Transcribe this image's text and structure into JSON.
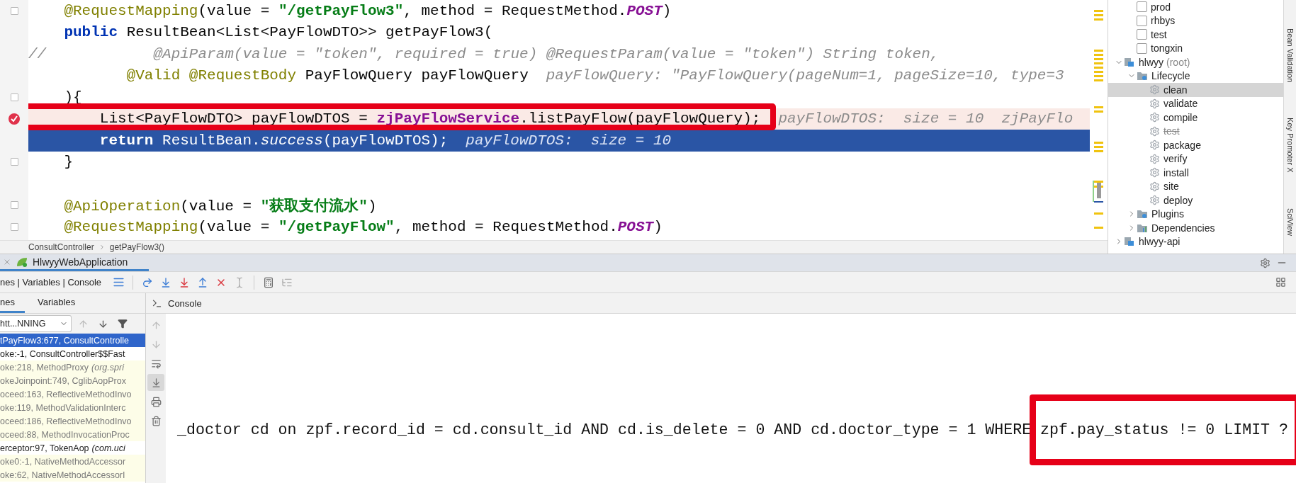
{
  "editor": {
    "lines": [
      {
        "fold": true,
        "boxed": false,
        "segments": [
          {
            "kind": "annotation",
            "text": "    @RequestMapping"
          },
          {
            "kind": "plain",
            "text": "(value = "
          },
          {
            "kind": "string",
            "text": "\"/getPayFlow3\""
          },
          {
            "kind": "plain",
            "text": ", method = RequestMethod."
          },
          {
            "kind": "constant",
            "text": "POST"
          },
          {
            "kind": "plain",
            "text": ")"
          }
        ]
      },
      {
        "fold": false,
        "boxed": false,
        "segments": [
          {
            "kind": "keyword",
            "text": "    public"
          },
          {
            "kind": "plain",
            "text": " ResultBean<List<PayFlowDTO>> getPayFlow3("
          }
        ]
      },
      {
        "fold": false,
        "boxed": false,
        "segments": [
          {
            "kind": "comment",
            "text": "//            @ApiParam(value = \"token\", required = true) @RequestParam(value = \"token\") String token,"
          }
        ]
      },
      {
        "fold": false,
        "boxed": false,
        "segments": [
          {
            "kind": "annotation",
            "text": "           @Valid "
          },
          {
            "kind": "annotation",
            "text": "@RequestBody"
          },
          {
            "kind": "plain",
            "text": " PayFlowQuery payFlowQuery"
          }
        ],
        "hint": "payFlowQuery: \"PayFlowQuery(pageNum=1, pageSize=10, type=3"
      },
      {
        "fold": true,
        "boxed": false,
        "segments": [
          {
            "kind": "plain",
            "text": "    ){"
          }
        ]
      },
      {
        "kind": "breakpoint",
        "fold": false,
        "boxed": true,
        "segments": [
          {
            "kind": "plain",
            "text": "        List<PayFlowDTO> payFlowDTOS = "
          },
          {
            "kind": "field",
            "text": "zjPayFlowService"
          },
          {
            "kind": "plain",
            "text": ".listPayFlow(payFlowQuery);"
          }
        ],
        "hint": "payFlowDTOS:  size = 10  zjPayFlo"
      },
      {
        "kind": "current",
        "fold": false,
        "boxed": false,
        "segments": [
          {
            "kind": "keyword",
            "text": "        return"
          },
          {
            "kind": "plain",
            "text": " ResultBean."
          },
          {
            "kind": "static",
            "text": "success"
          },
          {
            "kind": "plain",
            "text": "(payFlowDTOS);"
          }
        ],
        "hint": "payFlowDTOS:  size = 10"
      },
      {
        "fold": true,
        "boxed": false,
        "segments": [
          {
            "kind": "plain",
            "text": "    }"
          }
        ]
      },
      {
        "fold": false,
        "boxed": false
      },
      {
        "fold": true,
        "boxed": false,
        "segments": [
          {
            "kind": "annotation",
            "text": "    @ApiOperation"
          },
          {
            "kind": "plain",
            "text": "(value = "
          },
          {
            "kind": "string",
            "text": "\"获取支付流水\""
          },
          {
            "kind": "plain",
            "text": ")"
          }
        ]
      },
      {
        "fold": true,
        "boxed": false,
        "segments": [
          {
            "kind": "annotation",
            "text": "    @RequestMapping"
          },
          {
            "kind": "plain",
            "text": "(value = "
          },
          {
            "kind": "string",
            "text": "\"/getPayFlow\""
          },
          {
            "kind": "plain",
            "text": ", method = RequestMethod."
          },
          {
            "kind": "constant",
            "text": "POST"
          },
          {
            "kind": "plain",
            "text": ")"
          }
        ]
      }
    ],
    "breadcrumbs": [
      "ConsultController",
      "getPayFlow3()"
    ]
  },
  "maven": {
    "profiles": [
      {
        "label": "prod",
        "checked": false
      },
      {
        "label": "rhbys",
        "checked": false
      },
      {
        "label": "test",
        "checked": false
      },
      {
        "label": "tongxin",
        "checked": false
      }
    ],
    "tree": [
      {
        "label": "hlwyy",
        "note": "(root)",
        "kind": "module",
        "expanded": true,
        "selected": false,
        "children": [
          {
            "label": "Lifecycle",
            "kind": "lifecycle",
            "expanded": true,
            "selected": false,
            "children": [
              {
                "label": "clean",
                "kind": "goal",
                "selected": true,
                "skipped": false
              },
              {
                "label": "validate",
                "kind": "goal",
                "selected": false,
                "skipped": false
              },
              {
                "label": "compile",
                "kind": "goal",
                "selected": false,
                "skipped": false
              },
              {
                "label": "test",
                "kind": "goal",
                "selected": false,
                "skipped": true
              },
              {
                "label": "package",
                "kind": "goal",
                "selected": false,
                "skipped": false
              },
              {
                "label": "verify",
                "kind": "goal",
                "selected": false,
                "skipped": false
              },
              {
                "label": "install",
                "kind": "goal",
                "selected": false,
                "skipped": false
              },
              {
                "label": "site",
                "kind": "goal",
                "selected": false,
                "skipped": false
              },
              {
                "label": "deploy",
                "kind": "goal",
                "selected": false,
                "skipped": false
              }
            ]
          },
          {
            "label": "Plugins",
            "kind": "plugins",
            "expanded": false,
            "selected": false
          },
          {
            "label": "Dependencies",
            "kind": "dependencies",
            "expanded": false,
            "selected": false
          }
        ]
      },
      {
        "label": "hlwyy-api",
        "kind": "module",
        "expanded": false,
        "selected": false
      }
    ]
  },
  "side_tabs": [
    "Bean Validation",
    "Key Promoter X",
    "SciView"
  ],
  "debug": {
    "run_tab": "HlwyyWebApplication",
    "layout_label": "nes | Variables | Console",
    "tabs": [
      {
        "label": "nes",
        "selected": true
      },
      {
        "label": "Variables",
        "selected": false
      }
    ],
    "thread": "htt...NNING",
    "frames": [
      {
        "text": "tPayFlow3:677, ConsultControlle",
        "kind": "app",
        "selected": true
      },
      {
        "text": "oke:-1, ConsultController$$Fast",
        "kind": "app",
        "selected": false
      },
      {
        "text": "oke:218, MethodProxy",
        "package": "(org.spri",
        "kind": "library",
        "selected": false
      },
      {
        "text": "okeJoinpoint:749, CglibAopProx",
        "kind": "library",
        "selected": false
      },
      {
        "text": "oceed:163, ReflectiveMethodInvo",
        "kind": "library",
        "selected": false
      },
      {
        "text": "oke:119, MethodValidationInterc",
        "kind": "library",
        "selected": false
      },
      {
        "text": "oceed:186, ReflectiveMethodInvo",
        "kind": "library",
        "selected": false
      },
      {
        "text": "oceed:88, MethodInvocationProc",
        "kind": "library",
        "selected": false
      },
      {
        "text": "erceptor:97, TokenAop",
        "package": "(com.uci",
        "kind": "app",
        "selected": false
      },
      {
        "text": "oke0:-1, NativeMethodAccessor",
        "kind": "library",
        "selected": false
      },
      {
        "text": "oke:62, NativeMethodAccessorI",
        "kind": "library",
        "selected": false
      }
    ],
    "console_tab": "Console",
    "console_lines": [
      "_doctor cd on zpf.record_id = cd.consult_id AND cd.is_delete = 0 AND cd.doctor_type = 1 WHERE zpf.pay_status != 0 LIMIT ?"
    ]
  }
}
